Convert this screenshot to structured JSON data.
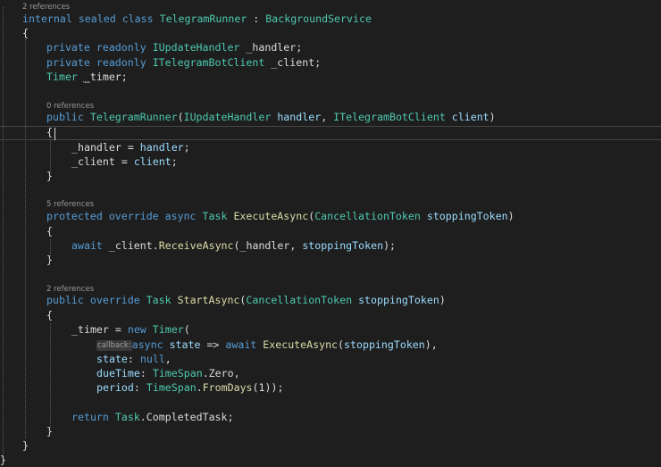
{
  "codelens": {
    "class_refs": "2 references",
    "ctor_refs": "0 references",
    "execute_refs": "5 references",
    "start_refs": "2 references"
  },
  "code": {
    "class_kw1": "internal",
    "class_kw2": "sealed",
    "class_kw3": "class",
    "class_name": "TelegramRunner",
    "class_colon": " : ",
    "base_type": "BackgroundService",
    "open_brace": "{",
    "close_brace": "}",
    "kw_private": "private",
    "kw_readonly": "readonly",
    "kw_public": "public",
    "kw_protected": "protected",
    "kw_override": "override",
    "kw_async": "async",
    "kw_await": "await",
    "kw_new": "new",
    "kw_return": "return",
    "kw_null": "null",
    "type_update_handler": "IUpdateHandler",
    "type_bot_client": "ITelegramBotClient",
    "type_timer": "Timer",
    "type_task": "Task",
    "type_cancellation": "CancellationToken",
    "type_timespan": "TimeSpan",
    "field_handler": "_handler",
    "field_client": "_client",
    "field_timer_prefix": "_",
    "field_timer_rest": "timer",
    "field_timer": "_timer",
    "semicolon": ";",
    "param_handler": "handler",
    "param_client": "client",
    "param_stopping": "stoppingToken",
    "method_execute": "ExecuteAsync",
    "method_start": "StartAsync",
    "method_receive": "ReceiveAsync",
    "method_fromdays": "FromDays",
    "ctor_open": "(",
    "ctor_comma": ", ",
    "ctor_close": ")",
    "assign": " = ",
    "dot": ".",
    "receive_args_open": "(",
    "receive_args_close": ");",
    "timer_open": "(",
    "hint_callback": "callback:",
    "lambda_arrow": " => ",
    "state_param": "state",
    "arg_end": "),",
    "arg_comma": ",",
    "named_state": "state",
    "named_duetime": "dueTime",
    "named_period": "period",
    "named_sep": ": ",
    "prop_zero": "Zero",
    "fromdays_arg": "(1));",
    "prop_completed": "CompletedTask"
  }
}
